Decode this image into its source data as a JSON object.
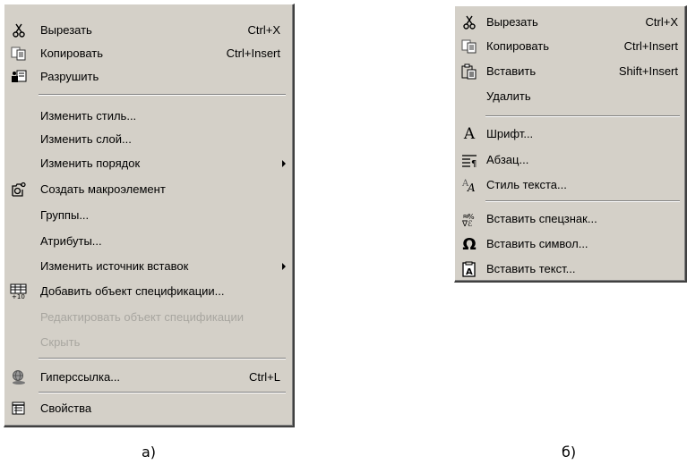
{
  "menu_a": {
    "items": [
      {
        "icon": "scissors-icon",
        "label": "Вырезать",
        "shortcut": "Ctrl+X"
      },
      {
        "icon": "copy-icon",
        "label": "Копировать",
        "shortcut": "Ctrl+Insert"
      },
      {
        "icon": "destroy-icon",
        "label": "Разрушить"
      },
      {
        "label": "Изменить стиль..."
      },
      {
        "label": "Изменить слой..."
      },
      {
        "label": "Изменить порядок",
        "submenu": true
      },
      {
        "icon": "macro-element-icon",
        "label": "Создать макроэлемент"
      },
      {
        "label": "Группы..."
      },
      {
        "label": "Атрибуты..."
      },
      {
        "label": "Изменить источник вставок",
        "submenu": true
      },
      {
        "icon": "spec-object-icon",
        "label": "Добавить объект спецификации..."
      },
      {
        "label": "Редактировать объект спецификации",
        "disabled": true
      },
      {
        "label": "Скрыть",
        "disabled": true
      },
      {
        "icon": "hyperlink-icon",
        "label": "Гиперссылка...",
        "shortcut": "Ctrl+L"
      },
      {
        "icon": "properties-icon",
        "label": "Свойства"
      }
    ],
    "caption": "а)"
  },
  "menu_b": {
    "items": [
      {
        "icon": "scissors-icon",
        "label": "Вырезать",
        "shortcut": "Ctrl+X"
      },
      {
        "icon": "copy-icon",
        "label": "Копировать",
        "shortcut": "Ctrl+Insert"
      },
      {
        "icon": "paste-icon",
        "label": "Вставить",
        "shortcut": "Shift+Insert"
      },
      {
        "label": "Удалить"
      },
      {
        "icon": "font-icon",
        "icon_glyph": "A",
        "label": "Шрифт..."
      },
      {
        "icon": "paragraph-icon",
        "label": "Абзац..."
      },
      {
        "icon": "text-style-icon",
        "label": "Стиль текста..."
      },
      {
        "icon": "special-char-icon",
        "label": "Вставить спецзнак..."
      },
      {
        "icon": "omega-icon",
        "icon_glyph": "Ω",
        "label": "Вставить символ..."
      },
      {
        "icon": "insert-text-icon",
        "label": "Вставить текст..."
      }
    ],
    "caption": "б)"
  }
}
